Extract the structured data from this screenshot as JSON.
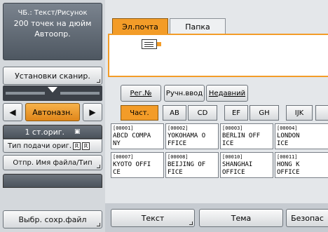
{
  "status": {
    "line1": "ЧБ.: Текст/Рисунок",
    "line2": "200 точек на дюйм",
    "line3": "Автоопр."
  },
  "left": {
    "scan_settings_label": "Установки сканир.",
    "auto_density_label": "Автоназн.",
    "left_arrow": "◀",
    "right_arrow": "▶",
    "originals_label": "1 ст.ориг.",
    "feed_type_label": "Тип подачи ориг.",
    "send_filename_label": "Отпр. Имя файла/Тип",
    "select_stored_label": "Выбр. сохр.файл"
  },
  "tabs": {
    "email": "Эл.почта",
    "folder": "Папка"
  },
  "controls": {
    "reg_no": "Рег.№",
    "manual": "Ручн.ввод",
    "recent": "Недавний"
  },
  "index_tabs": [
    "Част.",
    "AB",
    "CD",
    "EF",
    "GH",
    "IJK"
  ],
  "destinations": [
    {
      "num": "[00001]",
      "line1": "ABCD COMPA",
      "line2": "NY"
    },
    {
      "num": "[00002]",
      "line1": "YOKOHAMA O",
      "line2": "FFICE"
    },
    {
      "num": "[00003]",
      "line1": "BERLIN OFF",
      "line2": "ICE"
    },
    {
      "num": "[00004]",
      "line1": "LONDON",
      "line2": "ICE"
    },
    {
      "num": "[00007]",
      "line1": "KYOTO OFFI",
      "line2": "CE"
    },
    {
      "num": "[00008]",
      "line1": "BEIJING OF",
      "line2": "FICE"
    },
    {
      "num": "[00010]",
      "line1": "SHANGHAI",
      "line2": "OFFICE"
    },
    {
      "num": "[00011]",
      "line1": "HONG K",
      "line2": "OFFICE"
    }
  ],
  "bottom": {
    "text": "Текст",
    "subject": "Тема",
    "security": "Безопас"
  },
  "colors": {
    "accent": "#f39c28",
    "dark_panel": "#4e5761"
  }
}
